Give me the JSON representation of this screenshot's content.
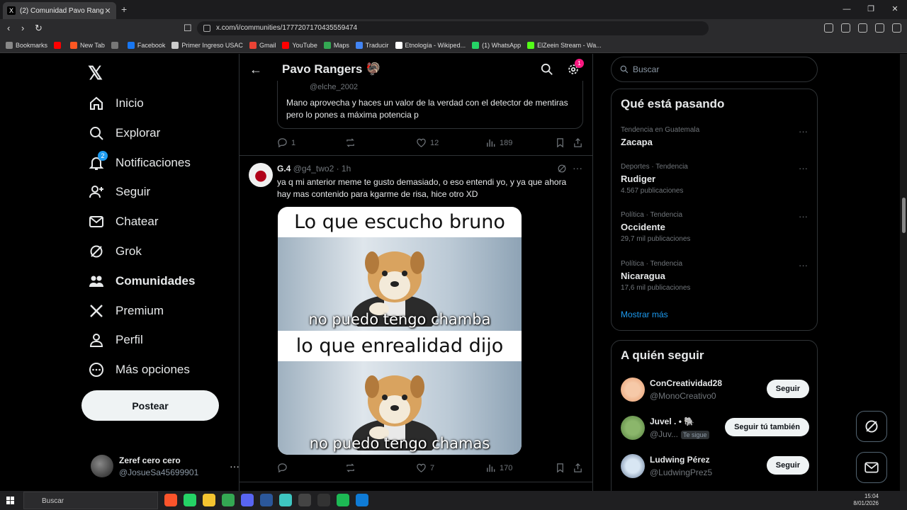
{
  "browser": {
    "tab_title": "(2) Comunidad Pavo Rangers",
    "tab_close": "✕",
    "new_tab": "+",
    "win_min": "—",
    "win_max": "❐",
    "win_close": "✕",
    "url": "x.com/i/communities/1777207170435559474",
    "bookmarks": [
      {
        "label": "Bookmarks",
        "color": "#888888"
      },
      {
        "label": "",
        "color": "#ff0000"
      },
      {
        "label": "New Tab",
        "color": "#ff5722"
      },
      {
        "label": "",
        "color": "#777777"
      },
      {
        "label": "Facebook",
        "color": "#1877f2"
      },
      {
        "label": "Primer Ingreso USAC",
        "color": "#cccccc"
      },
      {
        "label": "Gmail",
        "color": "#ea4335"
      },
      {
        "label": "YouTube",
        "color": "#ff0000"
      },
      {
        "label": "Maps",
        "color": "#34a853"
      },
      {
        "label": "Traducir",
        "color": "#4285f4"
      },
      {
        "label": "Etnología - Wikiped...",
        "color": "#ffffff"
      },
      {
        "label": "(1) WhatsApp",
        "color": "#25d366"
      },
      {
        "label": "ElZeein Stream - Wa...",
        "color": "#53fc18"
      }
    ]
  },
  "nav": {
    "items": [
      {
        "label": "Inicio",
        "icon": "home-icon"
      },
      {
        "label": "Explorar",
        "icon": "search-icon"
      },
      {
        "label": "Notificaciones",
        "icon": "bell-icon",
        "badge": "2"
      },
      {
        "label": "Seguir",
        "icon": "add-person-icon"
      },
      {
        "label": "Chatear",
        "icon": "mail-icon"
      },
      {
        "label": "Grok",
        "icon": "grok-icon"
      },
      {
        "label": "Comunidades",
        "icon": "communities-icon"
      },
      {
        "label": "Premium",
        "icon": "x-logo-icon"
      },
      {
        "label": "Perfil",
        "icon": "person-icon"
      },
      {
        "label": "Más opciones",
        "icon": "more-circle-icon"
      }
    ],
    "post_button": "Postear",
    "account": {
      "name": "Zeref cero cero",
      "handle": "@JosueSa45699901"
    }
  },
  "header": {
    "title": "Pavo Rangers 🦃",
    "gear_badge": "1"
  },
  "quote": {
    "handle": "@elche_2002",
    "text": "Mano aprovecha y haces un valor de la verdad con el detector de mentiras pero lo pones a máxima potencia p"
  },
  "quote_actions": {
    "replies": "1",
    "likes": "12",
    "views": "189"
  },
  "post": {
    "name": "G.4",
    "handle": "@g4_two2",
    "time": "· 1h",
    "text": "ya q mi anterior meme te gusto demasiado, o eso entendi yo, y ya que ahora hay mas contenido para kgarme de risa, hice otro XD",
    "meme": {
      "top_caption": "Lo que escucho bruno",
      "top_sub": "no puedo tengo chamba",
      "bottom_caption": "lo que enrealidad dijo",
      "bottom_sub": "no puedo tengo chamas"
    },
    "likes": "7",
    "views": "170"
  },
  "right": {
    "search_placeholder": "Buscar",
    "trends_title": "Qué está pasando",
    "trends": [
      {
        "context": "Tendencia en Guatemala",
        "name": "Zacapa",
        "count": ""
      },
      {
        "context": "Deportes · Tendencia",
        "name": "Rudiger",
        "count": "4.567 publicaciones"
      },
      {
        "context": "Política · Tendencia",
        "name": "Occidente",
        "count": "29,7 mil publicaciones"
      },
      {
        "context": "Política · Tendencia",
        "name": "Nicaragua",
        "count": "17,6 mil publicaciones"
      }
    ],
    "show_more": "Mostrar más",
    "follow_title": "A quién seguir",
    "follow": [
      {
        "name": "ConCreatividad28",
        "handle": "@MonoCreativo0",
        "button": "Seguir",
        "follows_you": ""
      },
      {
        "name": "Juvel . • 🐘",
        "handle": "@Juv...",
        "button": "Seguir tú también",
        "follows_you": "Te sigue"
      },
      {
        "name": "Ludwing Pérez",
        "handle": "@LudwingPrez5",
        "button": "Seguir",
        "follows_you": ""
      }
    ]
  },
  "taskbar": {
    "search": "Buscar",
    "time": "15:04",
    "date": "8/01/2026"
  },
  "colors": {
    "accent": "#1d9bf0",
    "background": "#000000",
    "pink_badge": "#f91880"
  }
}
